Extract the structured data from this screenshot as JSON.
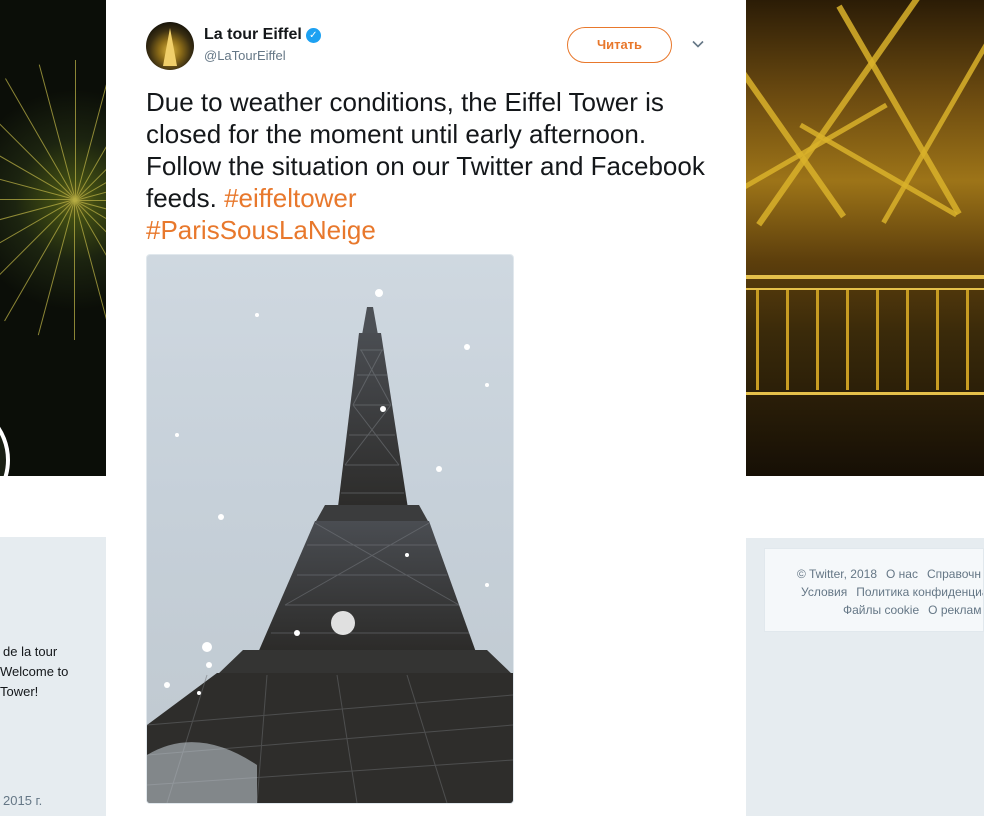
{
  "background": {
    "bio_lines": [
      "de la tour",
      "Welcome to",
      "Tower!"
    ],
    "joined": "2015 г.",
    "footer": {
      "row1": [
        "© Twitter, 2018",
        "О нас",
        "Справочн"
      ],
      "row2": [
        "Условия",
        "Политика конфиденциа"
      ],
      "row3": [
        "Файлы cookie",
        "О реклам"
      ]
    }
  },
  "tweet": {
    "display_name": "La tour Eiffel",
    "screen_name": "@LaTourEiffel",
    "verified": true,
    "follow_label": "Читать",
    "text_plain": "Due to weather conditions, the Eiffel Tower is closed for the moment until early afternoon. Follow the situation on our Twitter and Facebook feeds.",
    "hashtags": [
      "#eiffeltower",
      "#ParisSousLaNeige"
    ],
    "accent_color": "#e8782c"
  },
  "icons": {
    "verified": "verified-badge-icon",
    "caret": "chevron-down-icon"
  }
}
